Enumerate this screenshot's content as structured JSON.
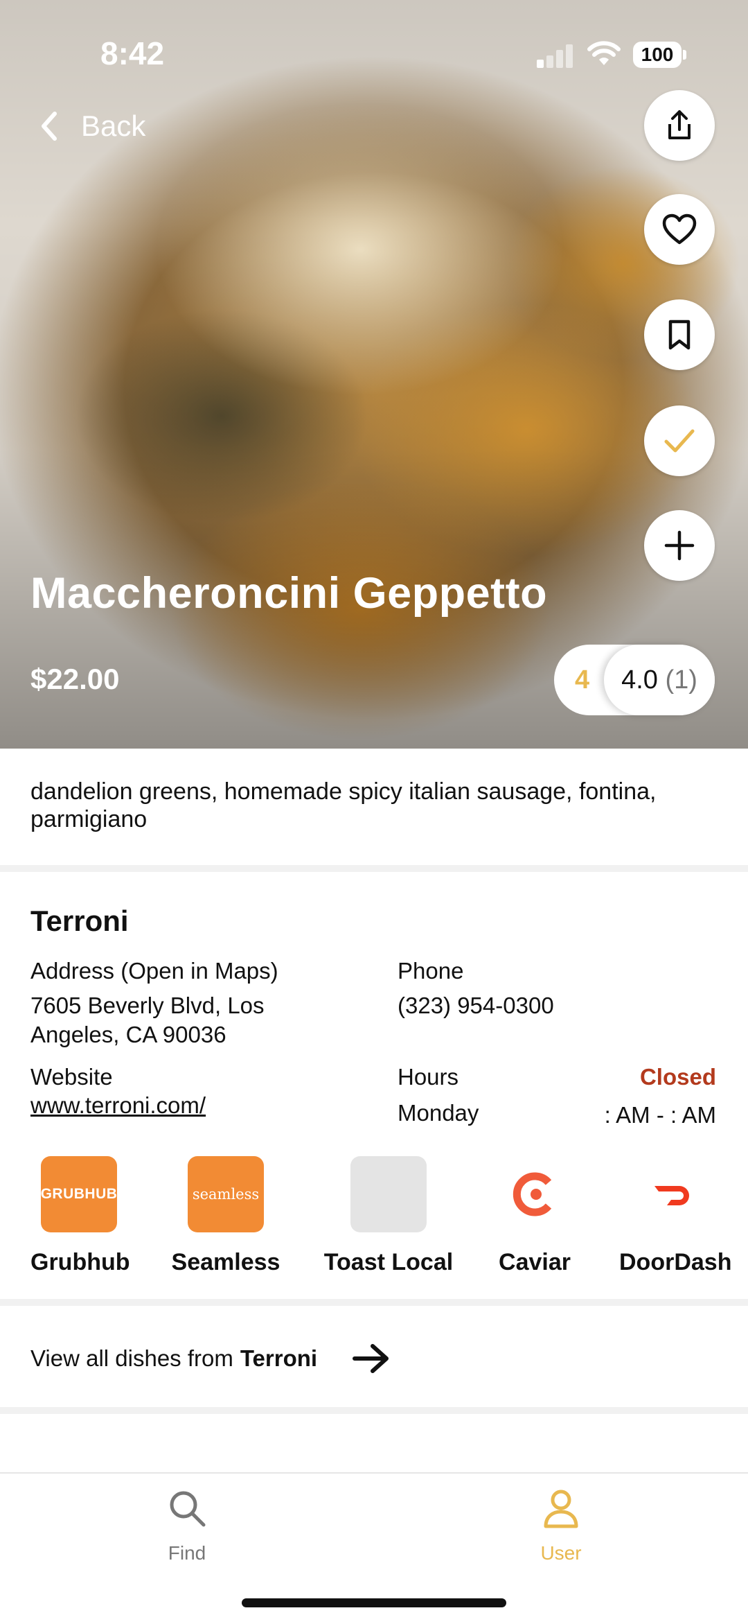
{
  "status_bar": {
    "time": "8:42",
    "battery": "100"
  },
  "nav": {
    "back_label": "Back"
  },
  "hero": {
    "dish_name": "Maccheroncini Geppetto",
    "price": "$22.00",
    "rating_user": "4",
    "rating_avg": "4.0",
    "rating_count": "(1)"
  },
  "actions": [
    "share-icon",
    "heart-icon",
    "bookmark-icon",
    "check-icon",
    "plus-icon"
  ],
  "description": "dandelion greens, homemade spicy italian sausage, fontina, parmigiano",
  "restaurant": {
    "name": "Terroni",
    "address_label": "Address (Open in Maps)",
    "address_line1": "7605 Beverly Blvd, Los",
    "address_line2": "Angeles, CA 90036",
    "phone_label": "Phone",
    "phone": "(323) 954-0300",
    "website_label": "Website",
    "website": "www.terroni.com/",
    "hours_label": "Hours",
    "hours_status": "Closed",
    "hours_day": "Monday",
    "hours_time": ": AM - : AM"
  },
  "delivery_services": [
    {
      "name": "Grubhub",
      "logo_text": "GRUBHUB"
    },
    {
      "name": "Seamless",
      "logo_text": "seamless"
    },
    {
      "name": "Toast Local",
      "logo_text": ""
    },
    {
      "name": "Caviar",
      "logo_text": ""
    },
    {
      "name": "DoorDash",
      "logo_text": ""
    }
  ],
  "view_all": {
    "prefix": "View all dishes from",
    "restaurant": "Terroni"
  },
  "tabbar": {
    "find_label": "Find",
    "user_label": "User"
  },
  "colors": {
    "accent": "#e8b84f",
    "closed": "#b33a1d",
    "grubhub": "#f28b34",
    "caviar": "#f05b3a",
    "doordash": "#f03a1f"
  }
}
